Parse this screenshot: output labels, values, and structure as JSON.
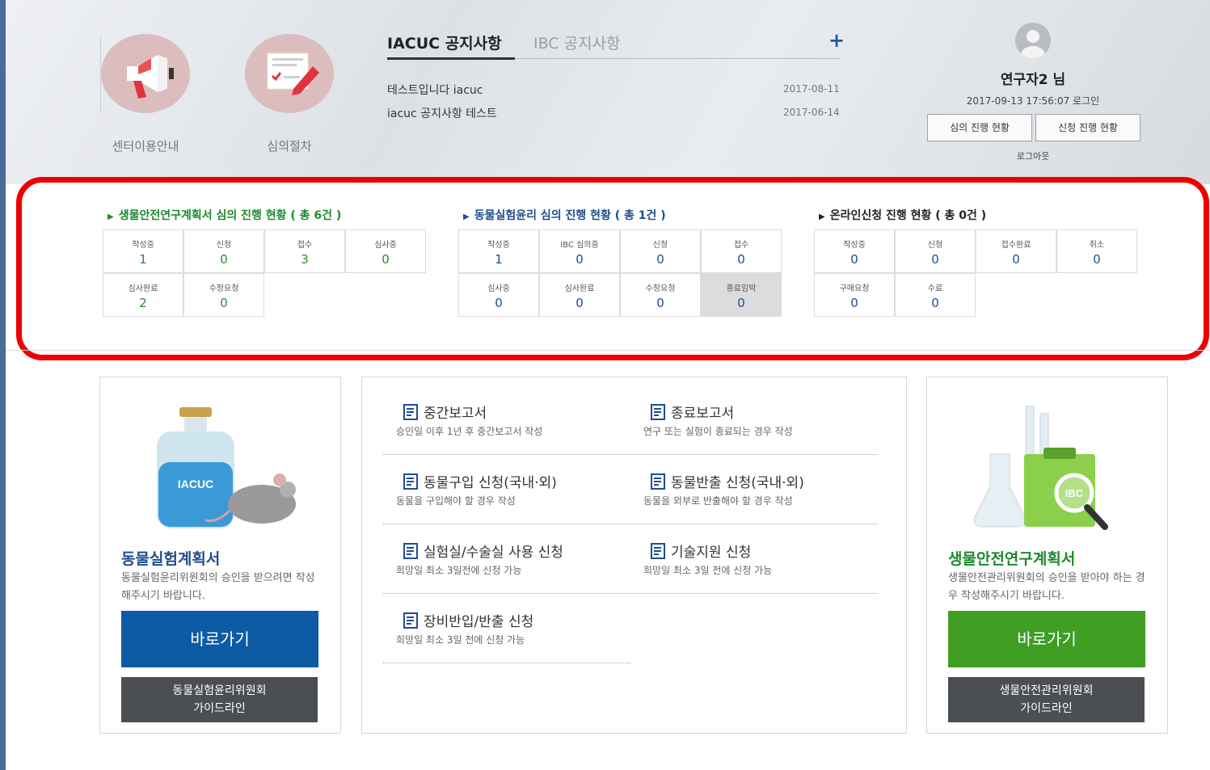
{
  "header": {
    "quick_links": [
      {
        "label": "센터이용안내",
        "icon": "megaphone-icon"
      },
      {
        "label": "심의절차",
        "icon": "checklist-icon"
      }
    ],
    "notice": {
      "tabs": [
        "IACUC 공지사항",
        "IBC 공지사항"
      ],
      "active_tab": 0,
      "more_label": "+",
      "items": [
        {
          "title": "테스트입니다 iacuc",
          "date": "2017-08-11"
        },
        {
          "title": "iacuc 공지사항 테스트",
          "date": "2017-06-14"
        }
      ]
    },
    "user": {
      "name": "연구자2 님",
      "login_info": "2017-09-13 17:56:07 로그인",
      "buttons": [
        "심의 진행 현황",
        "신청 진행 현황"
      ],
      "logout": "로그아웃"
    }
  },
  "status": [
    {
      "title": "생물안전연구계획서 심의 진행 현황 ( 총 6건 )",
      "cells": [
        {
          "label": "작성중",
          "value": "1"
        },
        {
          "label": "신청",
          "value": "0"
        },
        {
          "label": "접수",
          "value": "3"
        },
        {
          "label": "심사중",
          "value": "0"
        },
        {
          "label": "심사완료",
          "value": "2"
        },
        {
          "label": "수정요청",
          "value": "0"
        }
      ]
    },
    {
      "title": "동물실험윤리 심의 진행 현황 ( 총 1건 )",
      "cells": [
        {
          "label": "작성중",
          "value": "1"
        },
        {
          "label": "IBC 심의중",
          "value": "0"
        },
        {
          "label": "신청",
          "value": "0"
        },
        {
          "label": "접수",
          "value": "0"
        },
        {
          "label": "심사중",
          "value": "0"
        },
        {
          "label": "심사완료",
          "value": "0"
        },
        {
          "label": "수정요청",
          "value": "0"
        },
        {
          "label": "종료임박",
          "value": "0"
        }
      ]
    },
    {
      "title": "온라인신청 진행 현황 ( 총 0건 )",
      "cells": [
        {
          "label": "작성중",
          "value": "0"
        },
        {
          "label": "신청",
          "value": "0"
        },
        {
          "label": "접수완료",
          "value": "0"
        },
        {
          "label": "취소",
          "value": "0"
        },
        {
          "label": "구매요청",
          "value": "0"
        },
        {
          "label": "수료",
          "value": "0"
        }
      ]
    }
  ],
  "cards": {
    "left": {
      "illustration_label": "IACUC",
      "title": "동물실험계획서",
      "desc": "동물실험윤리위원회의 승인을 받으려면 작성해주시기 바랍니다.",
      "go_label": "바로가기",
      "guide_line1": "동물실험윤리위원회",
      "guide_line2": "가이드라인"
    },
    "right": {
      "illustration_label": "IBC",
      "title": "생물안전연구계획서",
      "desc": "생물안전관리위원회의 승인을 받아야 하는 경우 작성해주시기 바랍니다.",
      "go_label": "바로가기",
      "guide_line1": "생물안전관리위원회",
      "guide_line2": "가이드라인"
    }
  },
  "links": [
    {
      "title": "중간보고서",
      "desc": "승인일 이후 1년 후 중간보고서 작성"
    },
    {
      "title": "종료보고서",
      "desc": "연구 또는 실험이 종료되는 경우 작성"
    },
    {
      "title": "동물구입 신청(국내·외)",
      "desc": "동물을 구입해야 할 경우 작성"
    },
    {
      "title": "동물반출 신청(국내·외)",
      "desc": "동물을 외부로 반출해야 할 경우 작성"
    },
    {
      "title": "실험실/수술실 사용 신청",
      "desc": "희망일 최소 3일전에 신청 가능"
    },
    {
      "title": "기술지원 신청",
      "desc": "희망일 최소 3일 전에 신청 가능"
    },
    {
      "title": "장비반입/반출 신청",
      "desc": "희망일 최소 3일 전에 신청 가능"
    }
  ],
  "colors": {
    "status_highlight_border": "#ee0000",
    "iacuc_blue": "#0d5aa5",
    "ibc_green": "#3f9d24",
    "guide_gray": "#4b4f54"
  }
}
